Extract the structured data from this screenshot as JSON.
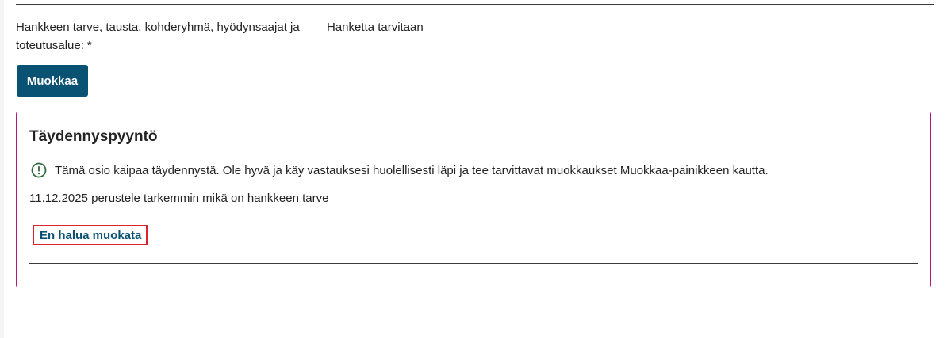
{
  "field": {
    "label": "Hankkeen tarve, tausta, kohderyhmä, hyödynsaajat ja toteutusalue:",
    "required_mark": "*",
    "value": "Hanketta tarvitaan"
  },
  "edit_button": {
    "label": "Muokkaa"
  },
  "completion_request": {
    "title": "Täydennyspyyntö",
    "info_icon": "exclamation-circle-icon",
    "info_text": "Tämä osio kaipaa täydennystä. Ole hyvä ja käy vastauksesi huolellisesti läpi ja tee tarvittavat muokkaukset Muokkaa-painikkeen kautta.",
    "note": "11.12.2025 perustele tarkemmin mikä on hankkeen tarve",
    "no_edit_link": "En halua muokata"
  },
  "colors": {
    "button_bg": "#0a5274",
    "box_border": "#b0197e",
    "link_text": "#0a5274",
    "highlight_border": "#d9232d",
    "icon_green": "#2e6b3f"
  }
}
